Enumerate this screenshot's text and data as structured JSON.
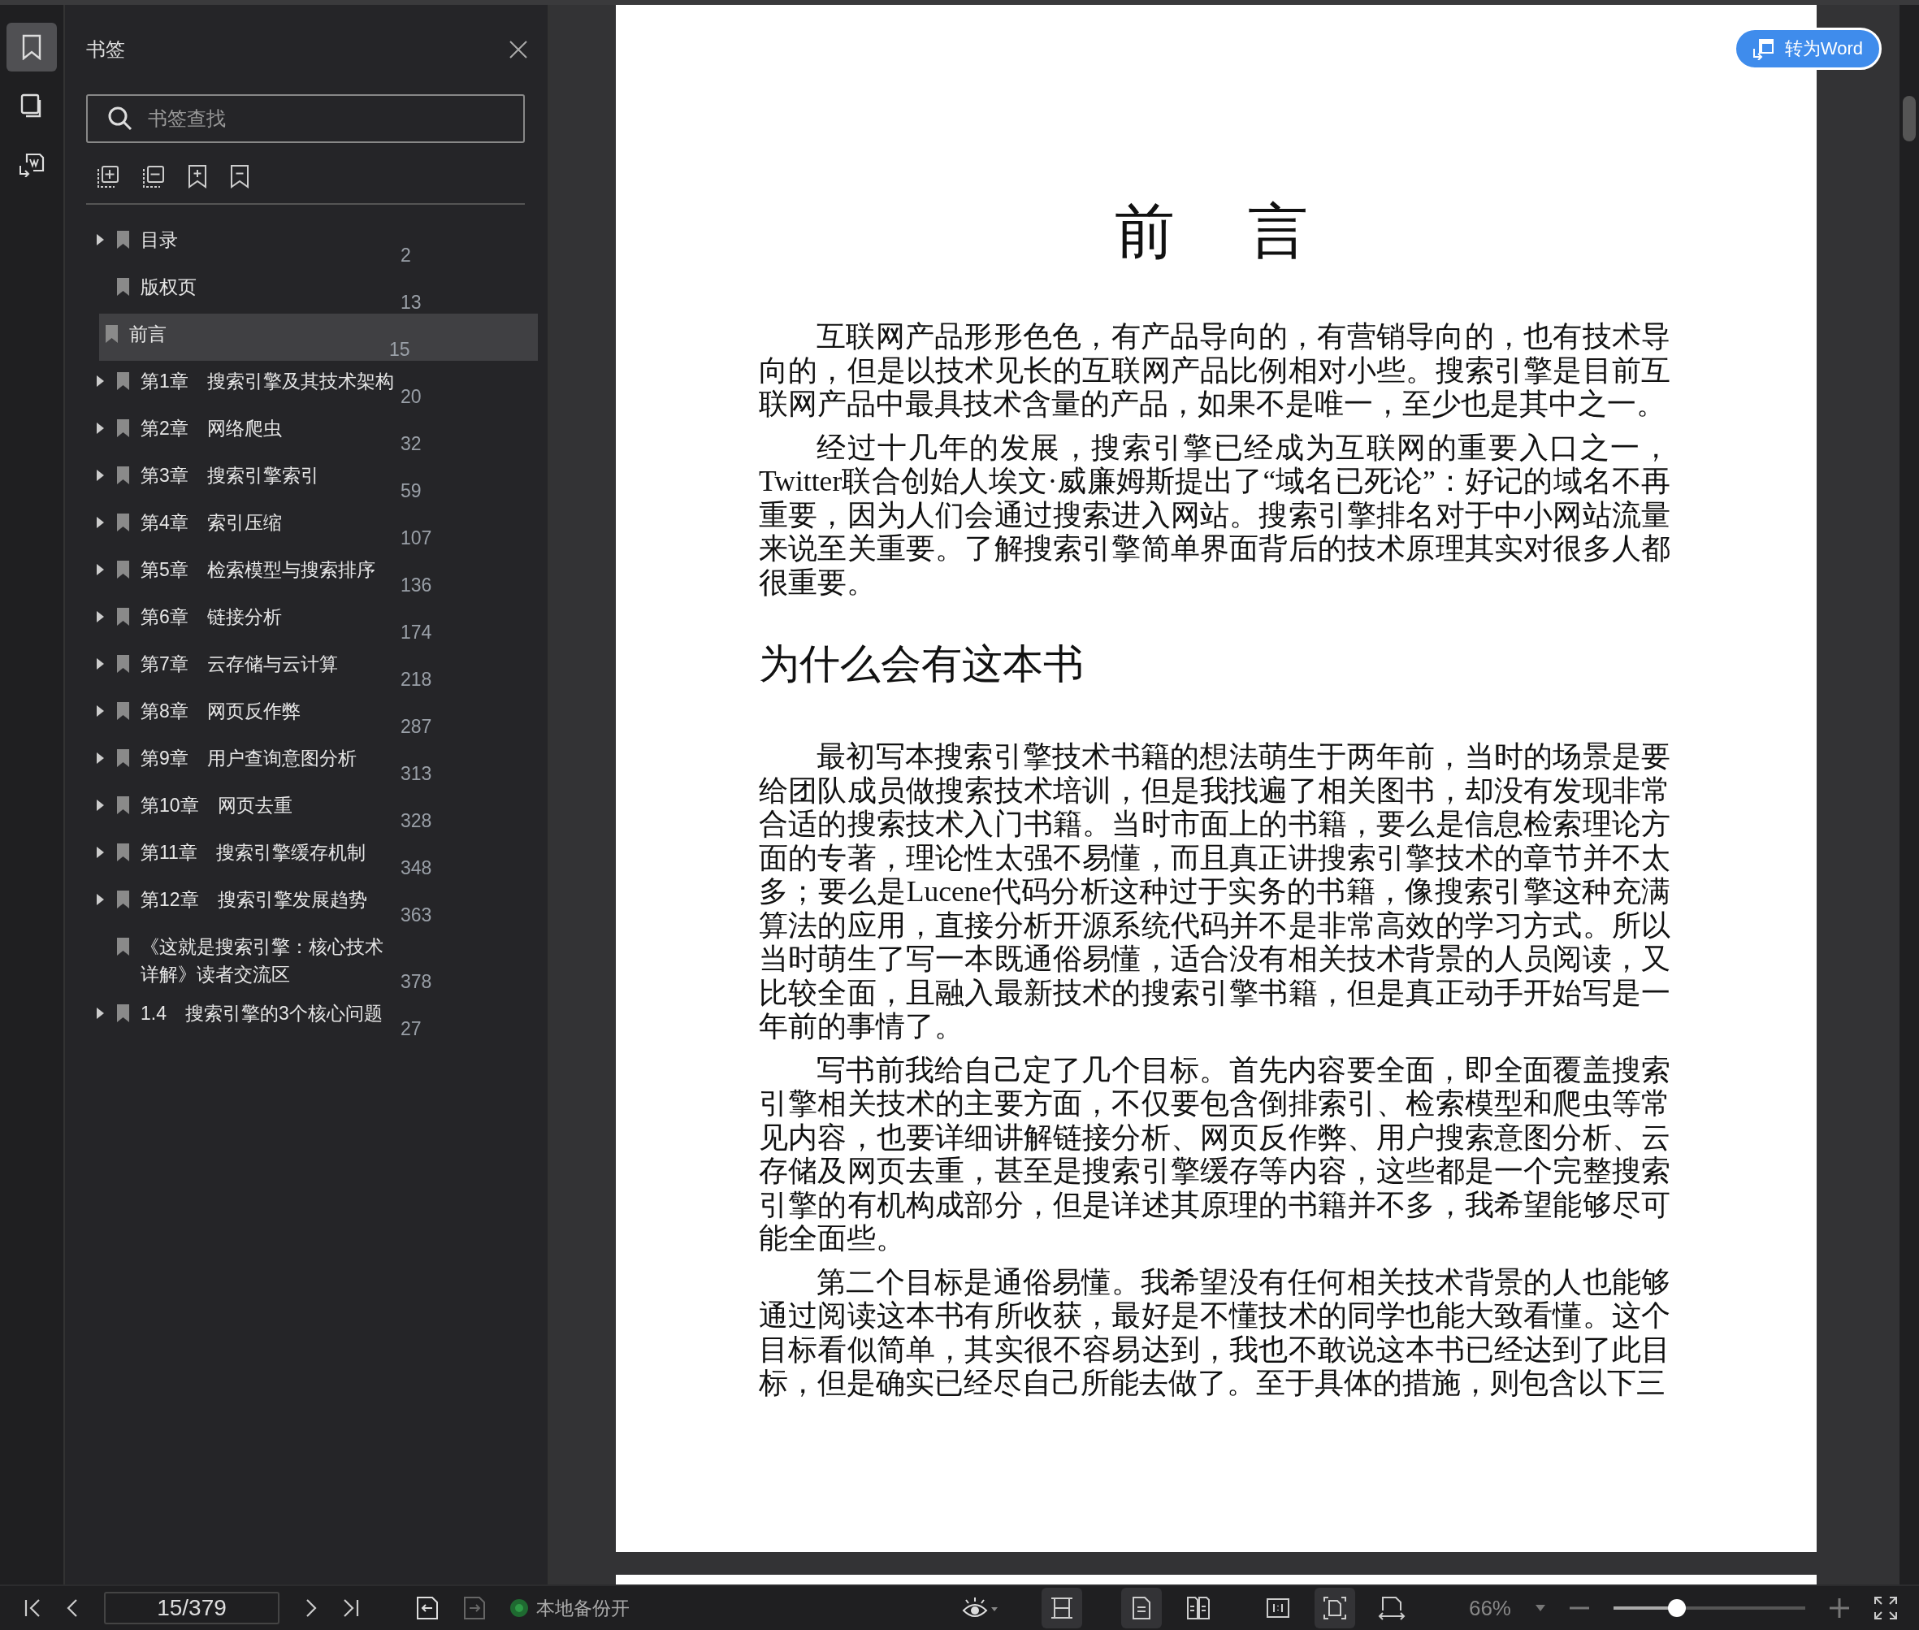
{
  "rail_tabs": [
    {
      "kind": "bookmark",
      "selected": true
    },
    {
      "kind": "pages",
      "selected": false
    },
    {
      "kind": "convert",
      "selected": false
    }
  ],
  "sidebar": {
    "title": "书签",
    "search": {
      "placeholder": "书签查找"
    },
    "items": [
      {
        "label": "目录",
        "page": "2",
        "has_children": true,
        "selected": false
      },
      {
        "label": "版权页",
        "page": "13",
        "has_children": false,
        "selected": false
      },
      {
        "label": "前言",
        "page": "15",
        "has_children": false,
        "selected": true
      },
      {
        "label": "第1章　搜索引擎及其技术架构",
        "page": "20",
        "has_children": true,
        "selected": false
      },
      {
        "label": "第2章　网络爬虫",
        "page": "32",
        "has_children": true,
        "selected": false
      },
      {
        "label": "第3章　搜索引擎索引",
        "page": "59",
        "has_children": true,
        "selected": false
      },
      {
        "label": "第4章　索引压缩",
        "page": "107",
        "has_children": true,
        "selected": false
      },
      {
        "label": "第5章　检索模型与搜索排序",
        "page": "136",
        "has_children": true,
        "selected": false
      },
      {
        "label": "第6章　链接分析",
        "page": "174",
        "has_children": true,
        "selected": false
      },
      {
        "label": "第7章　云存储与云计算",
        "page": "218",
        "has_children": true,
        "selected": false
      },
      {
        "label": "第8章　网页反作弊",
        "page": "287",
        "has_children": true,
        "selected": false
      },
      {
        "label": "第9章　用户查询意图分析",
        "page": "313",
        "has_children": true,
        "selected": false
      },
      {
        "label": "第10章　网页去重",
        "page": "328",
        "has_children": true,
        "selected": false
      },
      {
        "label": "第11章　搜索引擎缓存机制",
        "page": "348",
        "has_children": true,
        "selected": false
      },
      {
        "label": "第12章　搜索引擎发展趋势",
        "page": "363",
        "has_children": true,
        "selected": false
      },
      {
        "label": "《这就是搜索引擎：核心技术详解》读者交流区",
        "page": "378",
        "has_children": false,
        "selected": false
      },
      {
        "label": "1.4　搜索引擎的3个核心问题",
        "page": "27",
        "has_children": true,
        "selected": false
      }
    ]
  },
  "convert_button": "转为Word",
  "document": {
    "title": "前　言",
    "blocks": [
      {
        "kind": "p",
        "text": "互联网产品形形色色，有产品导向的，有营销导向的，也有技术导向的，但是以技术见长的互联网产品比例相对小些。搜索引擎是目前互联网产品中最具技术含量的产品，如果不是唯一，至少也是其中之一。"
      },
      {
        "kind": "p",
        "text": "经过十几年的发展，搜索引擎已经成为互联网的重要入口之一，Twitter联合创始人埃文·威廉姆斯提出了“域名已死论”：好记的域名不再重要，因为人们会通过搜索进入网站。搜索引擎排名对于中小网站流量来说至关重要。了解搜索引擎简单界面背后的技术原理其实对很多人都很重要。"
      },
      {
        "kind": "h2",
        "text": "为什么会有这本书"
      },
      {
        "kind": "p",
        "text": "最初写本搜索引擎技术书籍的想法萌生于两年前，当时的场景是要给团队成员做搜索技术培训，但是我找遍了相关图书，却没有发现非常合适的搜索技术入门书籍。当时市面上的书籍，要么是信息检索理论方面的专著，理论性太强不易懂，而且真正讲搜索引擎技术的章节并不太多；要么是Lucene代码分析这种过于实务的书籍，像搜索引擎这种充满算法的应用，直接分析开源系统代码并不是非常高效的学习方式。所以当时萌生了写一本既通俗易懂，适合没有相关技术背景的人员阅读，又比较全面，且融入最新技术的搜索引擎书籍，但是真正动手开始写是一年前的事情了。"
      },
      {
        "kind": "p",
        "text": "写书前我给自己定了几个目标。首先内容要全面，即全面覆盖搜索引擎相关技术的主要方面，不仅要包含倒排索引、检索模型和爬虫等常见内容，也要详细讲解链接分析、网页反作弊、用户搜索意图分析、云存储及网页去重，甚至是搜索引擎缓存等内容，这些都是一个完整搜索引擎的有机构成部分，但是详述其原理的书籍并不多，我希望能够尽可能全面些。"
      },
      {
        "kind": "p",
        "text": "第二个目标是通俗易懂。我希望没有任何相关技术背景的人也能够通过阅读这本书有所收获，最好是不懂技术的同学也能大致看懂。这个目标看似简单，其实很不容易达到，我也不敢说这本书已经达到了此目标，但是确实已经尽自己所能去做了。至于具体的措施，则包含以下三"
      }
    ]
  },
  "status_bar": {
    "page_field": "15/379",
    "backup": "本地备份开",
    "backup_on": true,
    "view_buttons": [
      {
        "kind": "continuous",
        "selected": true
      },
      {
        "kind": "single",
        "selected": true
      },
      {
        "kind": "double",
        "selected": false
      },
      {
        "kind": "actual",
        "selected": false
      },
      {
        "kind": "fit-page",
        "selected": true
      },
      {
        "kind": "fit-width",
        "selected": false
      }
    ],
    "zoom": "66%",
    "zoom_slider": {
      "level": 0.33
    }
  }
}
